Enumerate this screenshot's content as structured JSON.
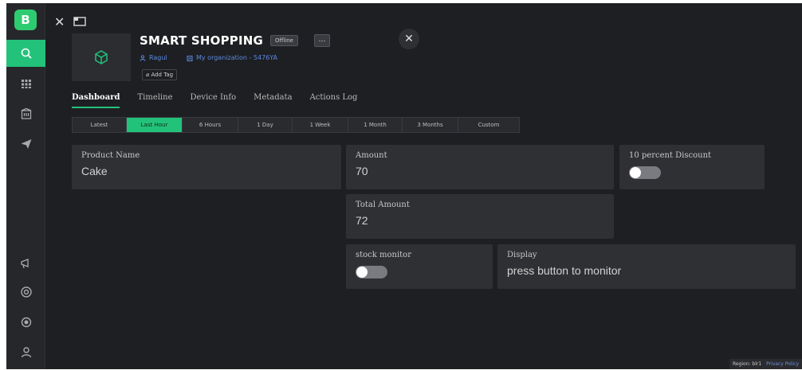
{
  "brand": {
    "letter": "B"
  },
  "device": {
    "title": "SMART SHOPPING",
    "status": "Offline",
    "more": "…",
    "owner": "Ragul",
    "organization": "My organization - 5476YA",
    "add_tag": "Add Tag"
  },
  "tabs": [
    "Dashboard",
    "Timeline",
    "Device Info",
    "Metadata",
    "Actions Log"
  ],
  "time_range": {
    "options": [
      "Latest",
      "Last Hour",
      "6 Hours",
      "1 Day",
      "1 Week",
      "1 Month",
      "3 Months",
      "Custom"
    ],
    "selected": "Last Hour"
  },
  "widgets": {
    "product_name": {
      "label": "Product Name",
      "value": "Cake"
    },
    "amount": {
      "label": "Amount",
      "value": "70"
    },
    "discount": {
      "label": "10 percent Discount",
      "state": "off"
    },
    "total_amount": {
      "label": "Total Amount",
      "value": "72"
    },
    "stock_monitor": {
      "label": "stock monitor",
      "state": "off"
    },
    "display": {
      "label": "Display",
      "value": "press button to monitor"
    }
  },
  "footer": {
    "region": "Region: blr1",
    "privacy": "Privacy Policy"
  },
  "colors": {
    "accent": "#23c27a",
    "background": "#1e1f22",
    "card": "#2f3034",
    "link": "#5b8ae0"
  }
}
